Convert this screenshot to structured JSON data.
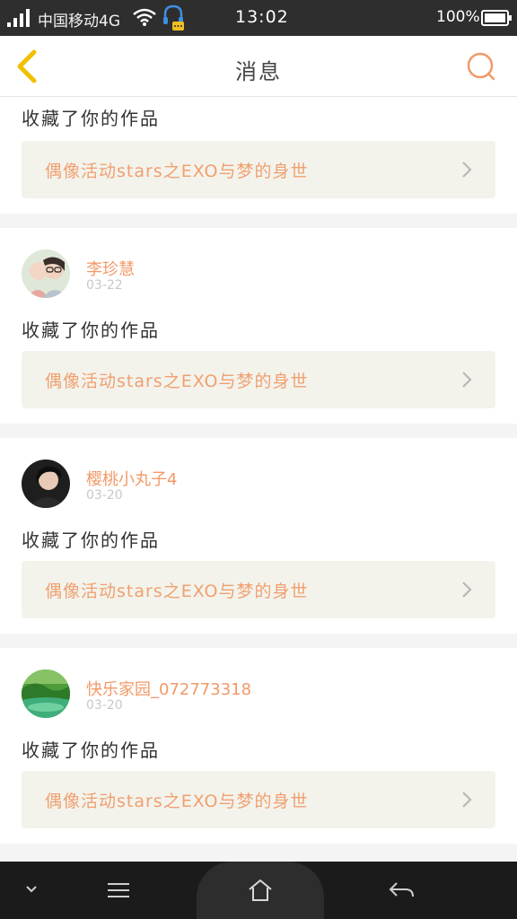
{
  "status_bar": {
    "carrier": "中国移动4G",
    "time": "13:02",
    "battery_percent": "100%",
    "icons": [
      "signal-icon",
      "wifi-icon",
      "headset-icon",
      "battery-icon"
    ]
  },
  "header": {
    "title": "消息",
    "back_icon": "chevron-left-icon",
    "search_icon": "search-icon",
    "accent_color": "#f29968"
  },
  "messages": [
    {
      "user": "",
      "date": "",
      "action": "收藏了你的作品",
      "work_title": "偶像活动stars之EXO与梦的身世"
    },
    {
      "user": "李珍慧",
      "date": "03-22",
      "action": "收藏了你的作品",
      "work_title": "偶像活动stars之EXO与梦的身世"
    },
    {
      "user": "樱桃小丸子4",
      "date": "03-20",
      "action": "收藏了你的作品",
      "work_title": "偶像活动stars之EXO与梦的身世"
    },
    {
      "user": "快乐家园_072773318",
      "date": "03-20",
      "action": "收藏了你的作品",
      "work_title": "偶像活动stars之EXO与梦的身世"
    }
  ],
  "nav_bar": {
    "icons": [
      "chevron-down-icon",
      "menu-icon",
      "home-icon",
      "back-arrow-icon"
    ]
  }
}
